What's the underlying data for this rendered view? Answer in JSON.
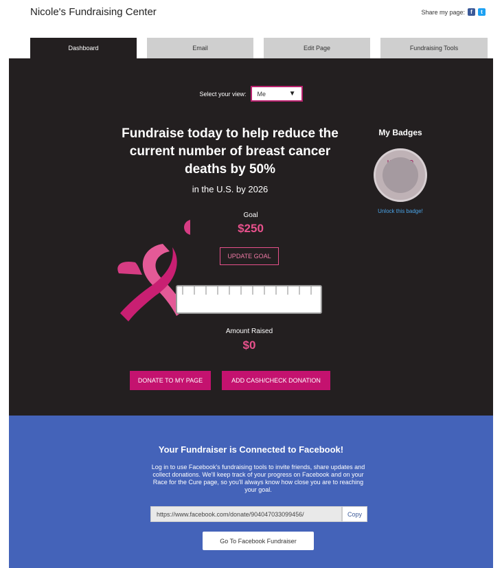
{
  "header": {
    "title": "Nicole's Fundraising Center",
    "share_label": "Share my page:",
    "facebook_glyph": "f",
    "twitter_glyph": "t"
  },
  "tabs": [
    {
      "label": "Dashboard",
      "active": true
    },
    {
      "label": "Email",
      "active": false
    },
    {
      "label": "Edit Page",
      "active": false
    },
    {
      "label": "Fundraising Tools",
      "active": false
    }
  ],
  "dashboard": {
    "view_label": "Select your view:",
    "view_value": "Me",
    "headline": "Fundraise today to help reduce the current number of breast cancer deaths by 50%",
    "subheadline": "in the U.S. by 2026",
    "goal_label": "Goal",
    "goal_value": "$250",
    "update_goal_label": "UPDATE GOAL",
    "progress_fraction": 0,
    "raised_label": "Amount Raised",
    "raised_value": "$0",
    "donate_button": "DONATE TO MY PAGE",
    "add_cash_button": "ADD CASH/CHECK DONATION",
    "badges_title": "My Badges",
    "badge_text": "I DONATED",
    "badge_link": "Unlock this badge!"
  },
  "facebook": {
    "title": "Your Fundraiser is Connected to Facebook!",
    "description": "Log in to use Facebook's fundraising tools to invite friends, share updates and collect donations. We'll keep track of your progress on Facebook and on your Race for the Cure page, so you'll always know how close you are to reaching your goal.",
    "url": "https://www.facebook.com/donate/904047033099456/",
    "copy_label": "Copy",
    "go_button": "Go To Facebook Fundraiser"
  },
  "colors": {
    "dark_bg": "#231f20",
    "pink_accent": "#c4126f",
    "pink_text": "#e8518c",
    "facebook_blue": "#4463b9"
  }
}
